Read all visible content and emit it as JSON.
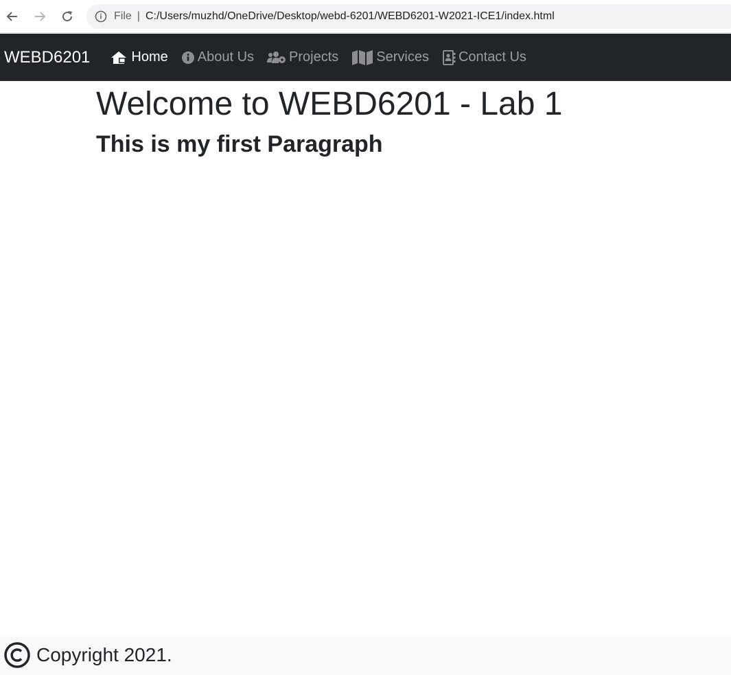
{
  "browser": {
    "back_icon": "arrow-left-icon",
    "forward_icon": "arrow-right-icon",
    "reload_icon": "reload-icon",
    "info_icon": "info-circle-icon",
    "file_label": "File",
    "separator": "|",
    "url": "C:/Users/muzhd/OneDrive/Desktop/webd-6201/WEBD6201-W2021-ICE1/index.html"
  },
  "navbar": {
    "brand": "WEBD6201",
    "background": "#212529",
    "items": [
      {
        "label": "Home",
        "icon": "house-user-icon",
        "active": true
      },
      {
        "label": "About Us",
        "icon": "info-circle-icon",
        "active": false
      },
      {
        "label": "Projects",
        "icon": "users-cog-icon",
        "active": false
      },
      {
        "label": "Services",
        "icon": "map-icon",
        "active": false
      },
      {
        "label": "Contact Us",
        "icon": "address-book-icon",
        "active": false
      }
    ]
  },
  "main": {
    "heading": "Welcome to WEBD6201 - Lab 1",
    "subheading": "This is my first Paragraph"
  },
  "footer": {
    "icon": "copyright-icon",
    "text": "Copyright 2021."
  }
}
